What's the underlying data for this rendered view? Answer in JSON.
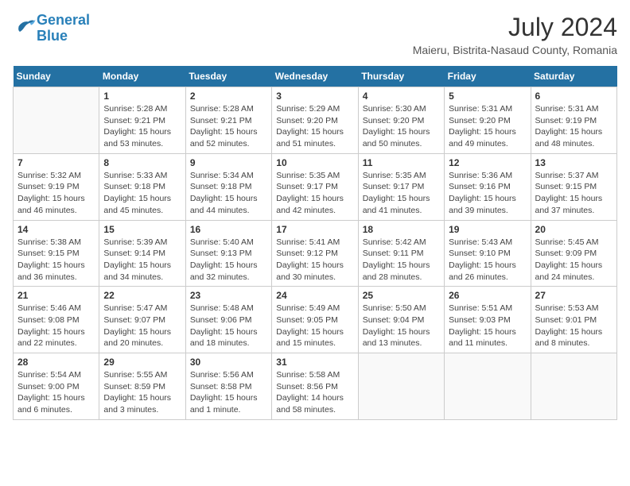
{
  "header": {
    "logo_line1": "General",
    "logo_line2": "Blue",
    "month_year": "July 2024",
    "location": "Maieru, Bistrita-Nasaud County, Romania"
  },
  "days_of_week": [
    "Sunday",
    "Monday",
    "Tuesday",
    "Wednesday",
    "Thursday",
    "Friday",
    "Saturday"
  ],
  "weeks": [
    [
      {
        "day": "",
        "info": ""
      },
      {
        "day": "1",
        "info": "Sunrise: 5:28 AM\nSunset: 9:21 PM\nDaylight: 15 hours\nand 53 minutes."
      },
      {
        "day": "2",
        "info": "Sunrise: 5:28 AM\nSunset: 9:21 PM\nDaylight: 15 hours\nand 52 minutes."
      },
      {
        "day": "3",
        "info": "Sunrise: 5:29 AM\nSunset: 9:20 PM\nDaylight: 15 hours\nand 51 minutes."
      },
      {
        "day": "4",
        "info": "Sunrise: 5:30 AM\nSunset: 9:20 PM\nDaylight: 15 hours\nand 50 minutes."
      },
      {
        "day": "5",
        "info": "Sunrise: 5:31 AM\nSunset: 9:20 PM\nDaylight: 15 hours\nand 49 minutes."
      },
      {
        "day": "6",
        "info": "Sunrise: 5:31 AM\nSunset: 9:19 PM\nDaylight: 15 hours\nand 48 minutes."
      }
    ],
    [
      {
        "day": "7",
        "info": "Sunrise: 5:32 AM\nSunset: 9:19 PM\nDaylight: 15 hours\nand 46 minutes."
      },
      {
        "day": "8",
        "info": "Sunrise: 5:33 AM\nSunset: 9:18 PM\nDaylight: 15 hours\nand 45 minutes."
      },
      {
        "day": "9",
        "info": "Sunrise: 5:34 AM\nSunset: 9:18 PM\nDaylight: 15 hours\nand 44 minutes."
      },
      {
        "day": "10",
        "info": "Sunrise: 5:35 AM\nSunset: 9:17 PM\nDaylight: 15 hours\nand 42 minutes."
      },
      {
        "day": "11",
        "info": "Sunrise: 5:35 AM\nSunset: 9:17 PM\nDaylight: 15 hours\nand 41 minutes."
      },
      {
        "day": "12",
        "info": "Sunrise: 5:36 AM\nSunset: 9:16 PM\nDaylight: 15 hours\nand 39 minutes."
      },
      {
        "day": "13",
        "info": "Sunrise: 5:37 AM\nSunset: 9:15 PM\nDaylight: 15 hours\nand 37 minutes."
      }
    ],
    [
      {
        "day": "14",
        "info": "Sunrise: 5:38 AM\nSunset: 9:15 PM\nDaylight: 15 hours\nand 36 minutes."
      },
      {
        "day": "15",
        "info": "Sunrise: 5:39 AM\nSunset: 9:14 PM\nDaylight: 15 hours\nand 34 minutes."
      },
      {
        "day": "16",
        "info": "Sunrise: 5:40 AM\nSunset: 9:13 PM\nDaylight: 15 hours\nand 32 minutes."
      },
      {
        "day": "17",
        "info": "Sunrise: 5:41 AM\nSunset: 9:12 PM\nDaylight: 15 hours\nand 30 minutes."
      },
      {
        "day": "18",
        "info": "Sunrise: 5:42 AM\nSunset: 9:11 PM\nDaylight: 15 hours\nand 28 minutes."
      },
      {
        "day": "19",
        "info": "Sunrise: 5:43 AM\nSunset: 9:10 PM\nDaylight: 15 hours\nand 26 minutes."
      },
      {
        "day": "20",
        "info": "Sunrise: 5:45 AM\nSunset: 9:09 PM\nDaylight: 15 hours\nand 24 minutes."
      }
    ],
    [
      {
        "day": "21",
        "info": "Sunrise: 5:46 AM\nSunset: 9:08 PM\nDaylight: 15 hours\nand 22 minutes."
      },
      {
        "day": "22",
        "info": "Sunrise: 5:47 AM\nSunset: 9:07 PM\nDaylight: 15 hours\nand 20 minutes."
      },
      {
        "day": "23",
        "info": "Sunrise: 5:48 AM\nSunset: 9:06 PM\nDaylight: 15 hours\nand 18 minutes."
      },
      {
        "day": "24",
        "info": "Sunrise: 5:49 AM\nSunset: 9:05 PM\nDaylight: 15 hours\nand 15 minutes."
      },
      {
        "day": "25",
        "info": "Sunrise: 5:50 AM\nSunset: 9:04 PM\nDaylight: 15 hours\nand 13 minutes."
      },
      {
        "day": "26",
        "info": "Sunrise: 5:51 AM\nSunset: 9:03 PM\nDaylight: 15 hours\nand 11 minutes."
      },
      {
        "day": "27",
        "info": "Sunrise: 5:53 AM\nSunset: 9:01 PM\nDaylight: 15 hours\nand 8 minutes."
      }
    ],
    [
      {
        "day": "28",
        "info": "Sunrise: 5:54 AM\nSunset: 9:00 PM\nDaylight: 15 hours\nand 6 minutes."
      },
      {
        "day": "29",
        "info": "Sunrise: 5:55 AM\nSunset: 8:59 PM\nDaylight: 15 hours\nand 3 minutes."
      },
      {
        "day": "30",
        "info": "Sunrise: 5:56 AM\nSunset: 8:58 PM\nDaylight: 15 hours\nand 1 minute."
      },
      {
        "day": "31",
        "info": "Sunrise: 5:58 AM\nSunset: 8:56 PM\nDaylight: 14 hours\nand 58 minutes."
      },
      {
        "day": "",
        "info": ""
      },
      {
        "day": "",
        "info": ""
      },
      {
        "day": "",
        "info": ""
      }
    ]
  ]
}
